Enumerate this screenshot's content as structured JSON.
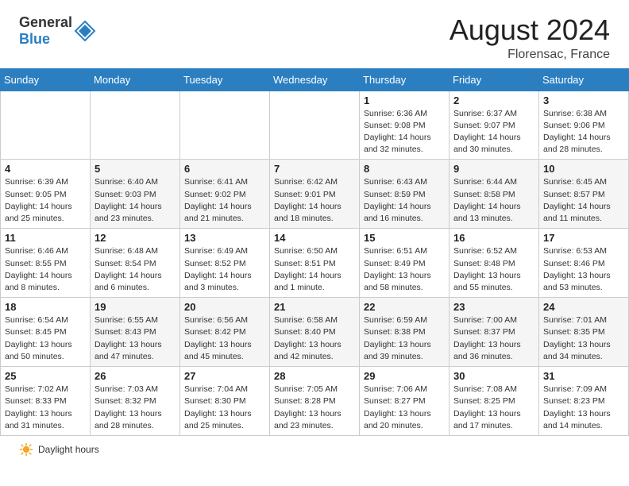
{
  "header": {
    "logo_general": "General",
    "logo_blue": "Blue",
    "month_year": "August 2024",
    "location": "Florensac, France"
  },
  "days_of_week": [
    "Sunday",
    "Monday",
    "Tuesday",
    "Wednesday",
    "Thursday",
    "Friday",
    "Saturday"
  ],
  "weeks": [
    [
      {
        "day": "",
        "info": ""
      },
      {
        "day": "",
        "info": ""
      },
      {
        "day": "",
        "info": ""
      },
      {
        "day": "",
        "info": ""
      },
      {
        "day": "1",
        "info": "Sunrise: 6:36 AM\nSunset: 9:08 PM\nDaylight: 14 hours and 32 minutes."
      },
      {
        "day": "2",
        "info": "Sunrise: 6:37 AM\nSunset: 9:07 PM\nDaylight: 14 hours and 30 minutes."
      },
      {
        "day": "3",
        "info": "Sunrise: 6:38 AM\nSunset: 9:06 PM\nDaylight: 14 hours and 28 minutes."
      }
    ],
    [
      {
        "day": "4",
        "info": "Sunrise: 6:39 AM\nSunset: 9:05 PM\nDaylight: 14 hours and 25 minutes."
      },
      {
        "day": "5",
        "info": "Sunrise: 6:40 AM\nSunset: 9:03 PM\nDaylight: 14 hours and 23 minutes."
      },
      {
        "day": "6",
        "info": "Sunrise: 6:41 AM\nSunset: 9:02 PM\nDaylight: 14 hours and 21 minutes."
      },
      {
        "day": "7",
        "info": "Sunrise: 6:42 AM\nSunset: 9:01 PM\nDaylight: 14 hours and 18 minutes."
      },
      {
        "day": "8",
        "info": "Sunrise: 6:43 AM\nSunset: 8:59 PM\nDaylight: 14 hours and 16 minutes."
      },
      {
        "day": "9",
        "info": "Sunrise: 6:44 AM\nSunset: 8:58 PM\nDaylight: 14 hours and 13 minutes."
      },
      {
        "day": "10",
        "info": "Sunrise: 6:45 AM\nSunset: 8:57 PM\nDaylight: 14 hours and 11 minutes."
      }
    ],
    [
      {
        "day": "11",
        "info": "Sunrise: 6:46 AM\nSunset: 8:55 PM\nDaylight: 14 hours and 8 minutes."
      },
      {
        "day": "12",
        "info": "Sunrise: 6:48 AM\nSunset: 8:54 PM\nDaylight: 14 hours and 6 minutes."
      },
      {
        "day": "13",
        "info": "Sunrise: 6:49 AM\nSunset: 8:52 PM\nDaylight: 14 hours and 3 minutes."
      },
      {
        "day": "14",
        "info": "Sunrise: 6:50 AM\nSunset: 8:51 PM\nDaylight: 14 hours and 1 minute."
      },
      {
        "day": "15",
        "info": "Sunrise: 6:51 AM\nSunset: 8:49 PM\nDaylight: 13 hours and 58 minutes."
      },
      {
        "day": "16",
        "info": "Sunrise: 6:52 AM\nSunset: 8:48 PM\nDaylight: 13 hours and 55 minutes."
      },
      {
        "day": "17",
        "info": "Sunrise: 6:53 AM\nSunset: 8:46 PM\nDaylight: 13 hours and 53 minutes."
      }
    ],
    [
      {
        "day": "18",
        "info": "Sunrise: 6:54 AM\nSunset: 8:45 PM\nDaylight: 13 hours and 50 minutes."
      },
      {
        "day": "19",
        "info": "Sunrise: 6:55 AM\nSunset: 8:43 PM\nDaylight: 13 hours and 47 minutes."
      },
      {
        "day": "20",
        "info": "Sunrise: 6:56 AM\nSunset: 8:42 PM\nDaylight: 13 hours and 45 minutes."
      },
      {
        "day": "21",
        "info": "Sunrise: 6:58 AM\nSunset: 8:40 PM\nDaylight: 13 hours and 42 minutes."
      },
      {
        "day": "22",
        "info": "Sunrise: 6:59 AM\nSunset: 8:38 PM\nDaylight: 13 hours and 39 minutes."
      },
      {
        "day": "23",
        "info": "Sunrise: 7:00 AM\nSunset: 8:37 PM\nDaylight: 13 hours and 36 minutes."
      },
      {
        "day": "24",
        "info": "Sunrise: 7:01 AM\nSunset: 8:35 PM\nDaylight: 13 hours and 34 minutes."
      }
    ],
    [
      {
        "day": "25",
        "info": "Sunrise: 7:02 AM\nSunset: 8:33 PM\nDaylight: 13 hours and 31 minutes."
      },
      {
        "day": "26",
        "info": "Sunrise: 7:03 AM\nSunset: 8:32 PM\nDaylight: 13 hours and 28 minutes."
      },
      {
        "day": "27",
        "info": "Sunrise: 7:04 AM\nSunset: 8:30 PM\nDaylight: 13 hours and 25 minutes."
      },
      {
        "day": "28",
        "info": "Sunrise: 7:05 AM\nSunset: 8:28 PM\nDaylight: 13 hours and 23 minutes."
      },
      {
        "day": "29",
        "info": "Sunrise: 7:06 AM\nSunset: 8:27 PM\nDaylight: 13 hours and 20 minutes."
      },
      {
        "day": "30",
        "info": "Sunrise: 7:08 AM\nSunset: 8:25 PM\nDaylight: 13 hours and 17 minutes."
      },
      {
        "day": "31",
        "info": "Sunrise: 7:09 AM\nSunset: 8:23 PM\nDaylight: 13 hours and 14 minutes."
      }
    ]
  ],
  "footer": {
    "daylight_label": "Daylight hours"
  }
}
